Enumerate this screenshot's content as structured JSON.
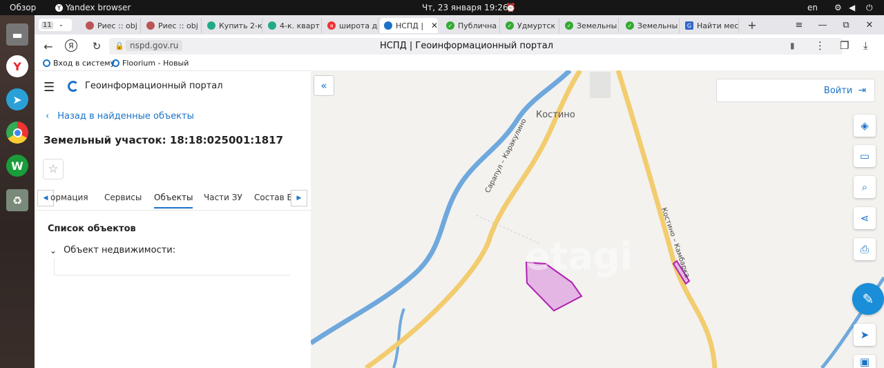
{
  "system": {
    "overview": "Обзор",
    "app": "Yandex browser",
    "datetime": "Чт, 23 января  19:26",
    "lang": "en"
  },
  "tabs": {
    "count": "11",
    "items": [
      {
        "label": "Риес :: obj",
        "color": "#b55"
      },
      {
        "label": "Риес :: obj",
        "color": "#b55"
      },
      {
        "label": "Купить 2-к",
        "color": "#2a8"
      },
      {
        "label": "4-к. кварт",
        "color": "#2a8"
      },
      {
        "label": "широта до",
        "color": "#e33"
      },
      {
        "label": "НСПД |",
        "color": "#1a73c8"
      },
      {
        "label": "Публична",
        "color": "#3a3"
      },
      {
        "label": "Удмуртск",
        "color": "#3a3"
      },
      {
        "label": "Земельны",
        "color": "#3a3"
      },
      {
        "label": "Земельны",
        "color": "#3a3"
      },
      {
        "label": "Найти мес",
        "color": "#36c"
      }
    ]
  },
  "address": {
    "url": "nspd.gov.ru",
    "title": "НСПД | Геоинформационный портал"
  },
  "bookmarks": [
    {
      "label": "Вход в систему"
    },
    {
      "label": "Floorium - Новый"
    }
  ],
  "panel": {
    "portal_title": "Геоинформационный портал",
    "back": "Назад в найденные объекты",
    "object_title": "Земельный участок: 18:18:025001:1817",
    "tabs": [
      "ормация",
      "Сервисы",
      "Объекты",
      "Части ЗУ",
      "Состав ЕЗ"
    ],
    "active_tab": "Объекты",
    "list_title": "Список объектов",
    "section": "Объект недвижимости:"
  },
  "map": {
    "login": "Войти",
    "village": "Костино",
    "road1": "Сарапул – Каракулино",
    "road2": "Костино – Камбарка",
    "watermark": "etagi"
  },
  "colors": {
    "accent": "#1a73c8",
    "parcel_fill": "#e3b6e3",
    "parcel_stroke": "#b020b0",
    "road": "#f2cc6e",
    "river": "#6fa8dc"
  }
}
